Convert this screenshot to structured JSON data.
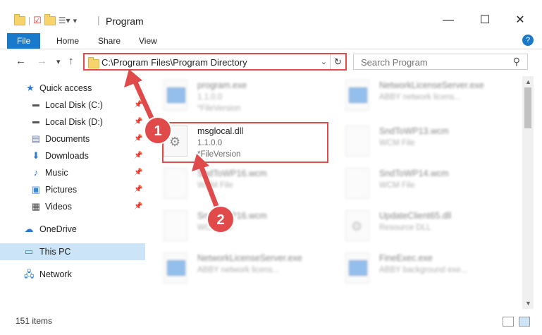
{
  "window": {
    "title": "Program",
    "controls": {
      "minimize": "—",
      "maximize": "☐",
      "close": "✕"
    }
  },
  "ribbon": {
    "tabs": [
      "File",
      "Home",
      "Share",
      "View"
    ],
    "help": "?"
  },
  "navigation": {
    "back": "←",
    "forward": "→",
    "recent": "▾",
    "up": "↑",
    "address": "C:\\Program Files\\Program Directory",
    "dropdown": "⌄",
    "refresh": "↻",
    "search_placeholder": "Search Program"
  },
  "sidebar": {
    "items": [
      {
        "label": "Quick access",
        "icon": "star-icon"
      },
      {
        "label": "Local Disk (C:)",
        "icon": "disk-icon"
      },
      {
        "label": "Local Disk (D:)",
        "icon": "disk-icon"
      },
      {
        "label": "Documents",
        "icon": "document-icon"
      },
      {
        "label": "Downloads",
        "icon": "download-icon"
      },
      {
        "label": "Music",
        "icon": "music-icon"
      },
      {
        "label": "Pictures",
        "icon": "picture-icon"
      },
      {
        "label": "Videos",
        "icon": "video-icon"
      },
      {
        "label": "OneDrive",
        "icon": "cloud-icon"
      },
      {
        "label": "This PC",
        "icon": "computer-icon"
      },
      {
        "label": "Network",
        "icon": "network-icon"
      }
    ]
  },
  "files": [
    {
      "name": "program.exe",
      "line1": "1.1.0.0",
      "line2": "*FileVersion"
    },
    {
      "name": "NetworkLicenseServer.exe",
      "line1": "ABBY network licens...",
      "line2": ""
    },
    {
      "name": "msglocal.dll",
      "line1": "1.1.0.0",
      "line2": "*FileVersion"
    },
    {
      "name": "SndToWP13.wcm",
      "line1": "WCM File",
      "line2": ""
    },
    {
      "name": "SndToWP16.wcm",
      "line1": "WCM File",
      "line2": ""
    },
    {
      "name": "SndToWP14.wcm",
      "line1": "WCM File",
      "line2": ""
    },
    {
      "name": "SndToWP16.wcm",
      "line1": "WCM File",
      "line2": ""
    },
    {
      "name": "UpdateClient65.dll",
      "line1": "Resource DLL",
      "line2": ""
    },
    {
      "name": "NetworkLicenseServer.exe",
      "line1": "ABBY network licens...",
      "line2": ""
    },
    {
      "name": "FineExec.exe",
      "line1": "ABBY background exe...",
      "line2": ""
    }
  ],
  "status": {
    "item_count": "151 items"
  },
  "annotations": {
    "step1": "1",
    "step2": "2",
    "color": "#e04a4a"
  }
}
